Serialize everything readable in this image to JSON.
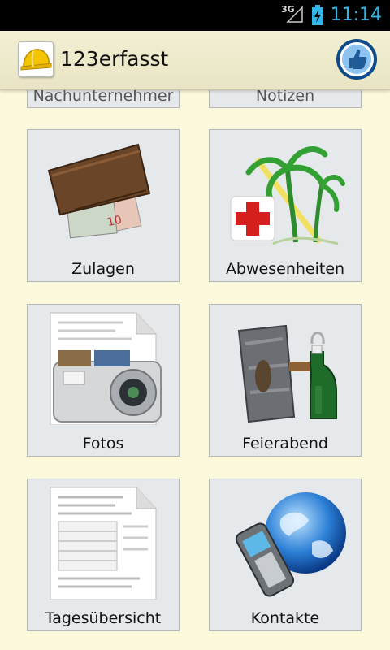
{
  "status_bar": {
    "network": "3G",
    "time": "11:14"
  },
  "app": {
    "title": "123erfasst"
  },
  "tiles": [
    {
      "label": "Nachunternehmer",
      "icon": "subcontractor-icon"
    },
    {
      "label": "Notizen",
      "icon": "notes-icon"
    },
    {
      "label": "Zulagen",
      "icon": "wallet-money-icon"
    },
    {
      "label": "Abwesenheiten",
      "icon": "absence-palm-cross-icon"
    },
    {
      "label": "Fotos",
      "icon": "camera-icon"
    },
    {
      "label": "Feierabend",
      "icon": "hammer-bottle-icon"
    },
    {
      "label": "Tagesübersicht",
      "icon": "document-icon"
    },
    {
      "label": "Kontakte",
      "icon": "phone-globe-icon"
    }
  ]
}
